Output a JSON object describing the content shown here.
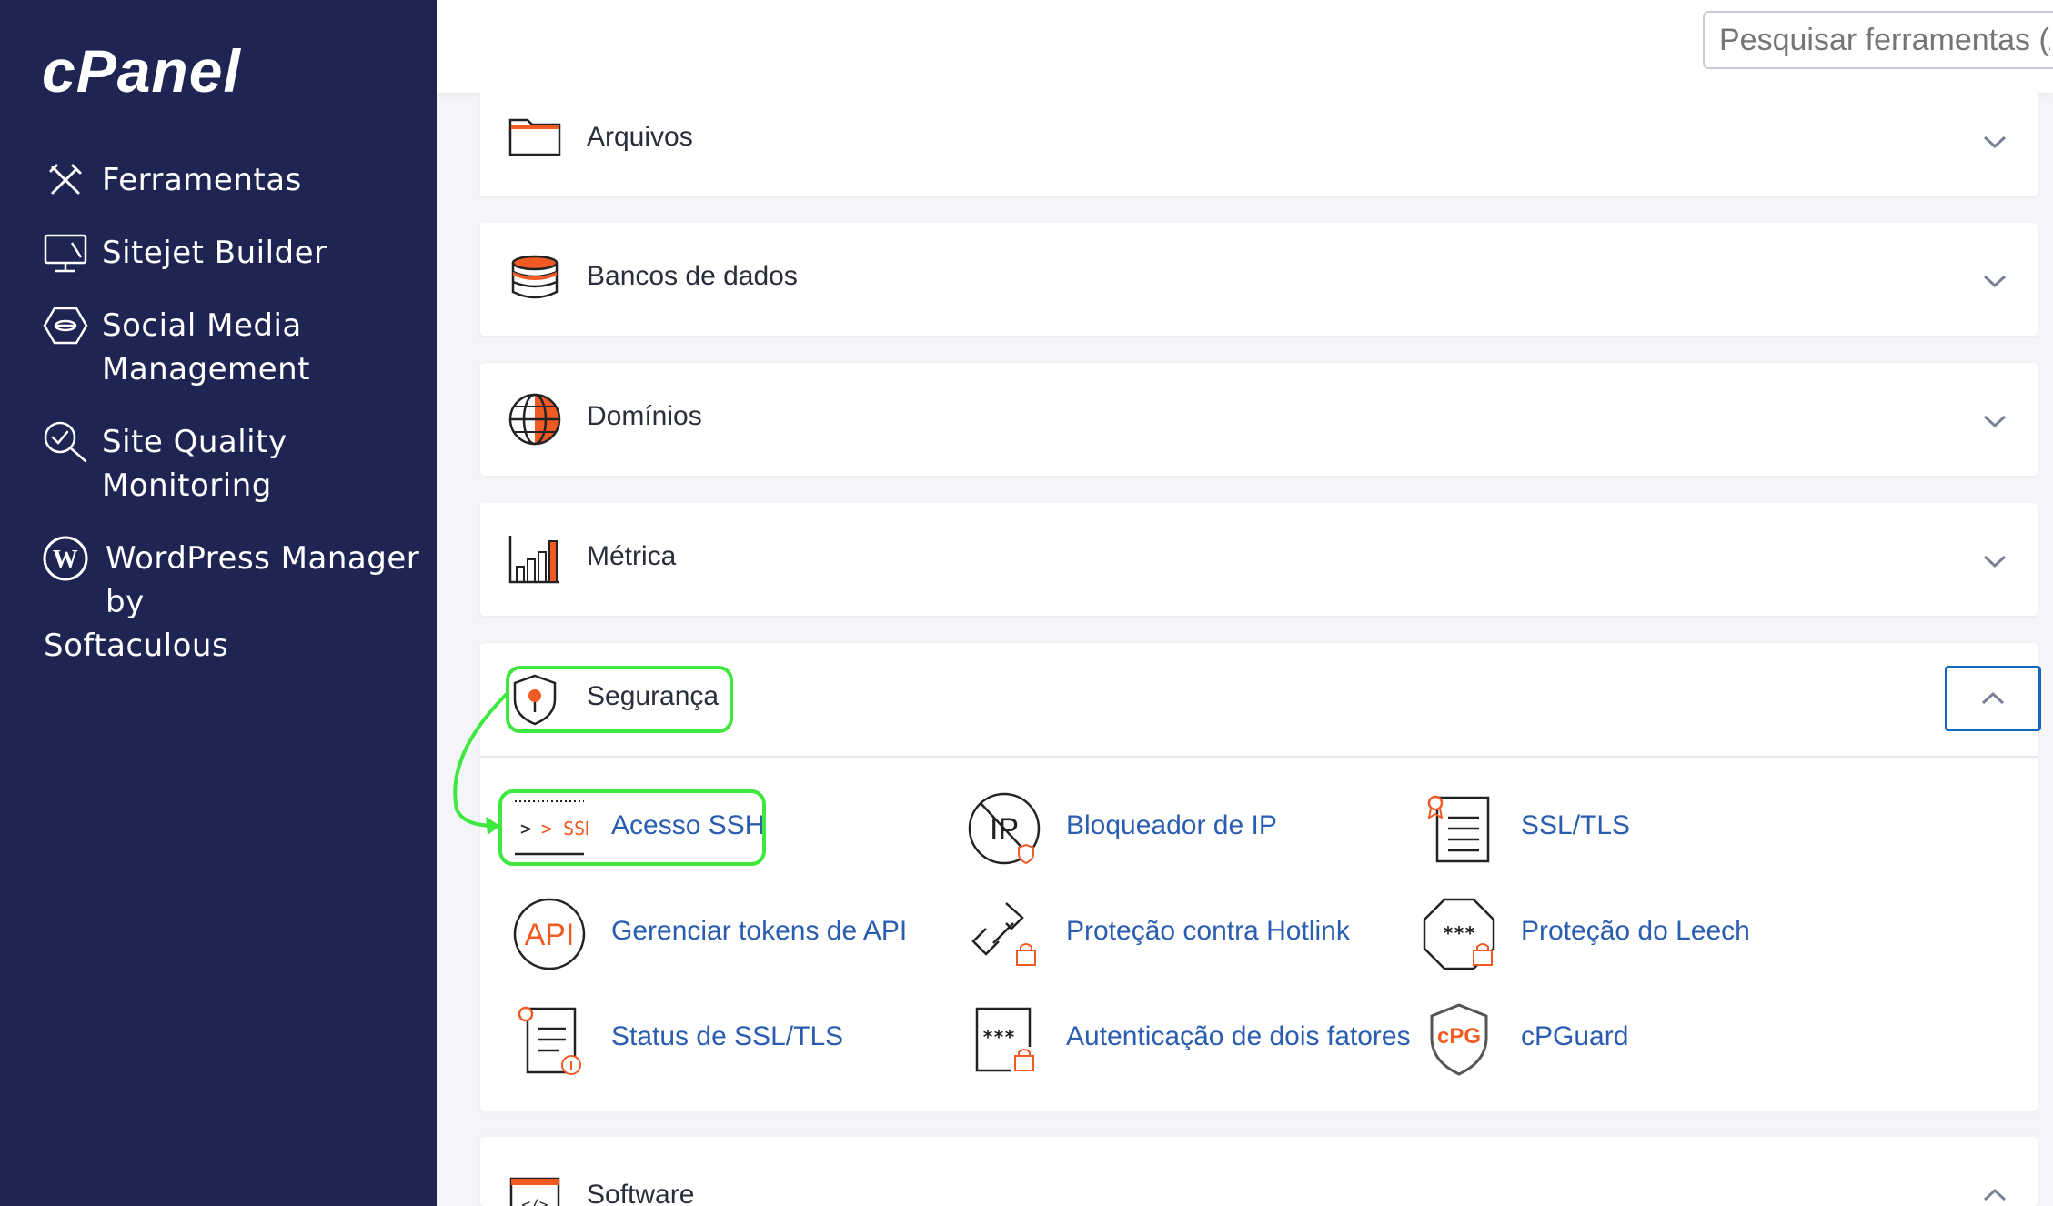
{
  "app": {
    "logo": "cPanel"
  },
  "sidebar": {
    "items": [
      {
        "label": "Ferramentas",
        "icon": "tools-icon"
      },
      {
        "label": "Sitejet Builder",
        "icon": "monitor-builder-icon"
      },
      {
        "label": "Social Media Management",
        "icon": "social-media-icon"
      },
      {
        "label": "Site Quality Monitoring",
        "icon": "magnifier-check-icon"
      },
      {
        "label": "WordPress Manager by",
        "label_tail": "Softaculous",
        "icon": "wordpress-icon"
      }
    ]
  },
  "search": {
    "placeholder": "Pesquisar ferramentas (/)"
  },
  "sections": [
    {
      "title": "Arquivos",
      "icon": "folder-icon",
      "expanded": false
    },
    {
      "title": "Bancos de dados",
      "icon": "database-icon",
      "expanded": false
    },
    {
      "title": "Domínios",
      "icon": "globe-icon",
      "expanded": false
    },
    {
      "title": "Métrica",
      "icon": "bar-chart-icon",
      "expanded": false
    },
    {
      "title": "Segurança",
      "icon": "shield-icon",
      "expanded": true,
      "tools": [
        {
          "label": "Acesso SSH",
          "icon": "ssh-terminal-icon",
          "icon_text": ">_SSH"
        },
        {
          "label": "Bloqueador de IP",
          "icon": "ip-blocker-icon",
          "icon_text": "IP"
        },
        {
          "label": "SSL/TLS",
          "icon": "ssl-certificate-icon"
        },
        {
          "label": "Gerenciar tokens de API",
          "icon": "api-icon",
          "icon_text": "API"
        },
        {
          "label": "Proteção contra Hotlink",
          "icon": "hotlink-icon"
        },
        {
          "label": "Proteção do Leech",
          "icon": "leech-icon",
          "icon_text": "***"
        },
        {
          "label": "Status de SSL/TLS",
          "icon": "ssl-status-icon"
        },
        {
          "label": "Autenticação de dois fatores",
          "icon": "two-factor-icon",
          "icon_text": "***"
        },
        {
          "label": "cPGuard",
          "icon": "cpguard-icon",
          "icon_text": "cPG"
        }
      ]
    },
    {
      "title": "Software",
      "icon": "software-code-icon",
      "expanded": true
    }
  ],
  "colors": {
    "sidebar": "#1f2552",
    "accent_orange": "#f15a22",
    "link_blue": "#2a5db0",
    "highlight_green": "#3ee83e",
    "button_blue": "#1565c0"
  }
}
